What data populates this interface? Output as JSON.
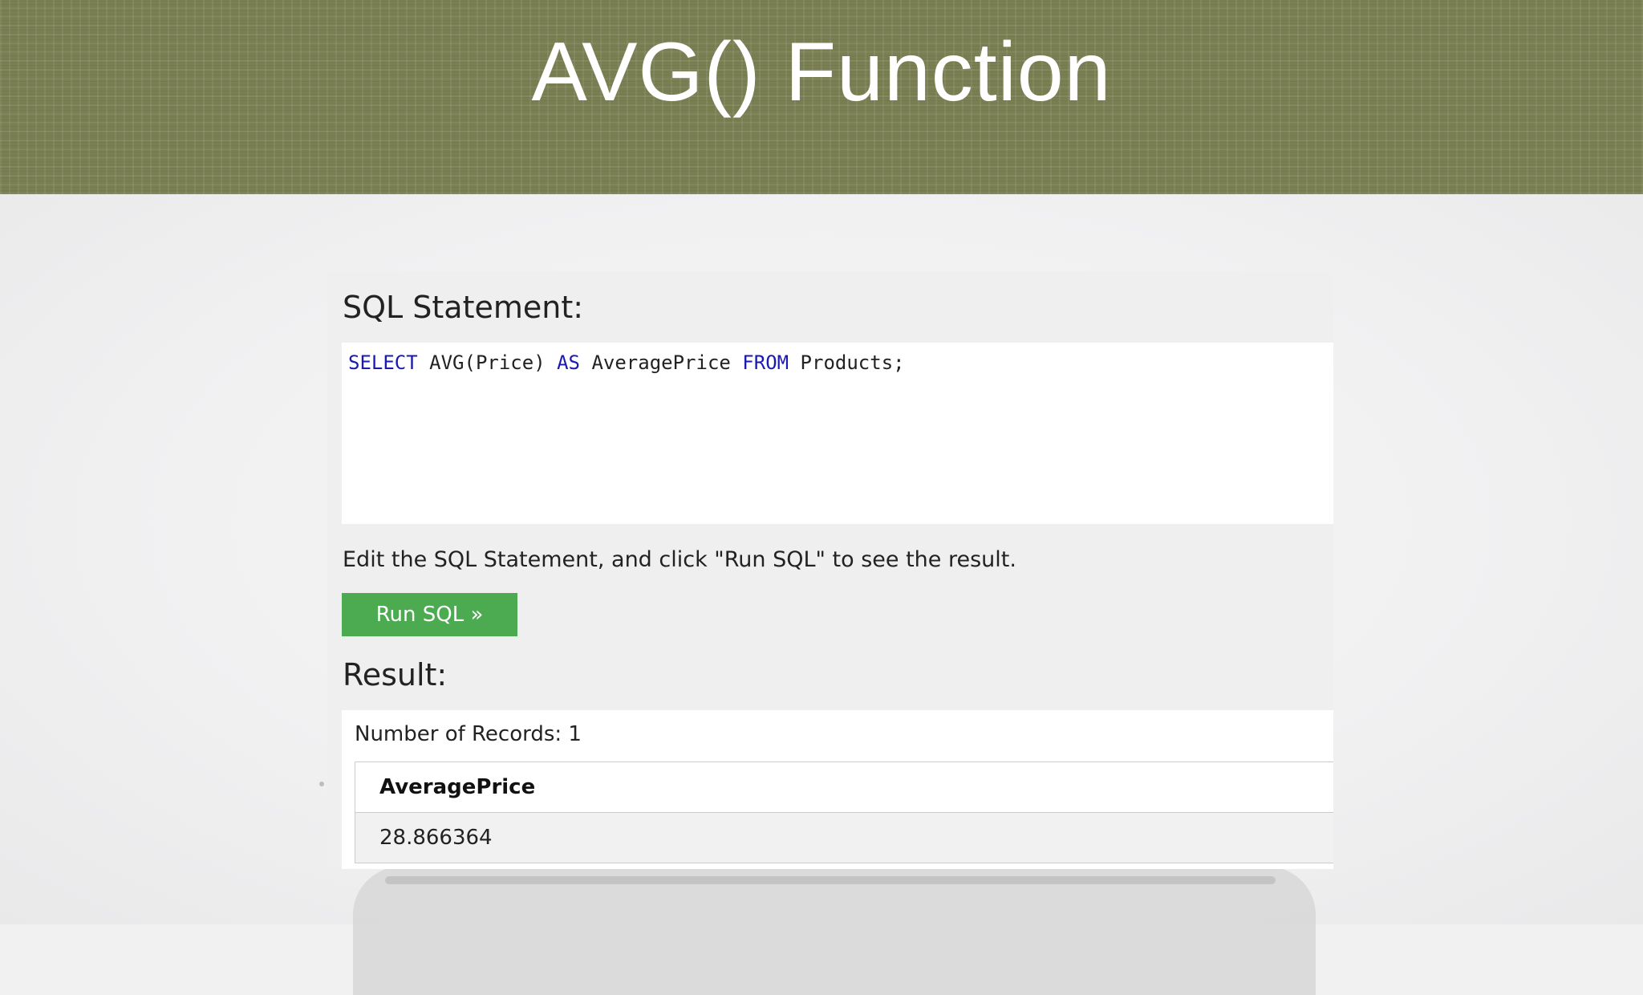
{
  "slide": {
    "title": "AVG() Function"
  },
  "editor": {
    "heading": "SQL Statement:",
    "tokens": {
      "select": "SELECT",
      "expr": " AVG(Price) ",
      "as": "AS",
      "alias": " AveragePrice ",
      "from": "FROM",
      "table": " Products;"
    },
    "keyword_color": "#1a1ab0"
  },
  "instructions": "Edit the SQL Statement, and click \"Run SQL\" to see the result.",
  "run_button": {
    "label": "Run SQL »",
    "color": "#4caa50"
  },
  "result": {
    "heading": "Result:",
    "records_text": "Number of Records: 1",
    "columns": [
      "AveragePrice"
    ],
    "rows": [
      [
        "28.866364"
      ]
    ]
  },
  "colors": {
    "banner": "#7a7f53",
    "page_background": "#f1f1f2"
  }
}
